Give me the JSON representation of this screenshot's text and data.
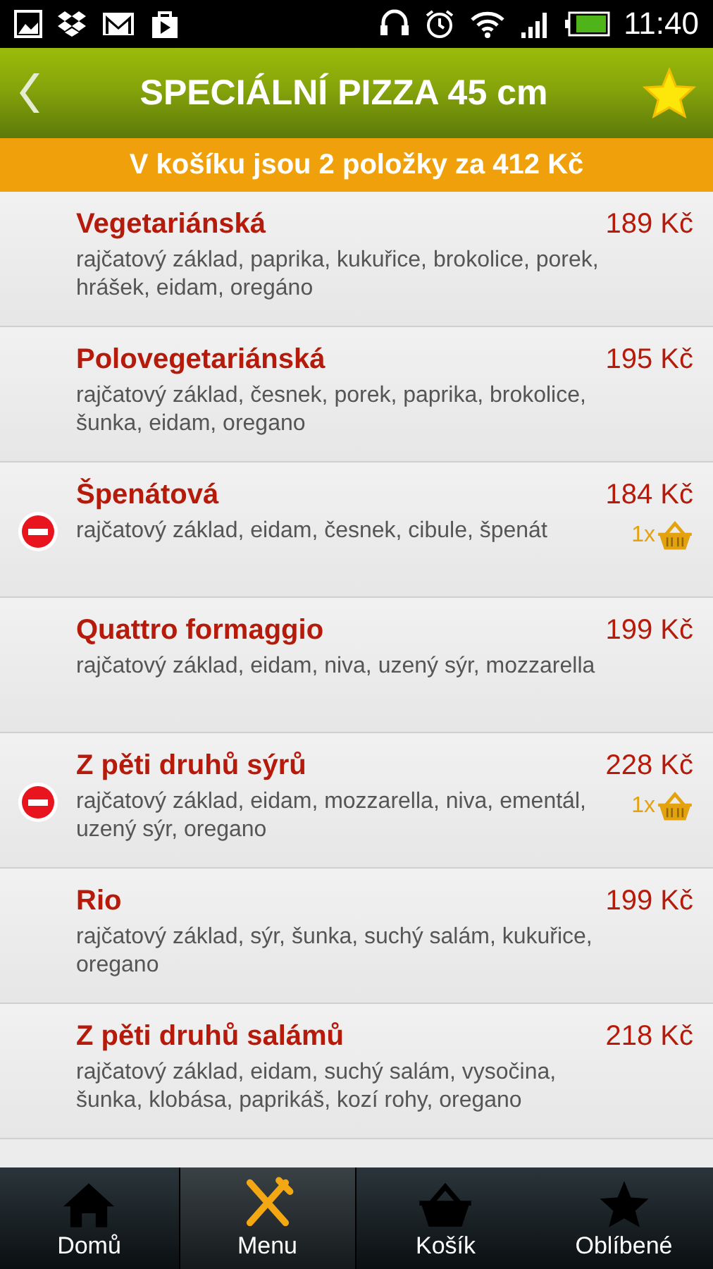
{
  "status_bar": {
    "time": "11:40"
  },
  "header": {
    "title": "SPECIÁLNÍ PIZZA 45 cm",
    "favorite": true
  },
  "cart_banner": "V košíku jsou 2 položky za 412 Kč",
  "items": [
    {
      "name": "Vegetariánská",
      "price": "189 Kč",
      "description": "rajčatový základ, paprika, kukuřice, brokolice, porek, hrášek, eidam, oregáno",
      "in_cart": false
    },
    {
      "name": "Polovegetariánská",
      "price": "195 Kč",
      "description": "rajčatový základ, česnek, porek, paprika, brokolice, šunka, eidam, oregano",
      "in_cart": false
    },
    {
      "name": "Špenátová",
      "price": "184 Kč",
      "description": "rajčatový základ, eidam, česnek, cibule, špenát",
      "in_cart": true,
      "quantity": "1x"
    },
    {
      "name": "Quattro formaggio",
      "price": "199 Kč",
      "description": "rajčatový základ, eidam, niva, uzený sýr, mozzarella",
      "in_cart": false
    },
    {
      "name": "Z pěti druhů sýrů",
      "price": "228 Kč",
      "description": "rajčatový základ, eidam, mozzarella, niva, ementál, uzený sýr, oregano",
      "in_cart": true,
      "quantity": "1x"
    },
    {
      "name": "Rio",
      "price": "199 Kč",
      "description": "rajčatový základ, sýr, šunka, suchý salám, kukuřice, oregano",
      "in_cart": false
    },
    {
      "name": "Z pěti druhů salámů",
      "price": "218 Kč",
      "description": "rajčatový základ, eidam, suchý salám, vysočina, šunka, klobása, paprikáš, kozí rohy, oregano",
      "in_cart": false
    }
  ],
  "nav": [
    {
      "kind": "home",
      "label": "Domů",
      "selected": false
    },
    {
      "kind": "menu",
      "label": "Menu",
      "selected": true
    },
    {
      "kind": "cart",
      "label": "Košík",
      "selected": false
    },
    {
      "kind": "favorites",
      "label": "Oblíbené",
      "selected": false
    }
  ]
}
